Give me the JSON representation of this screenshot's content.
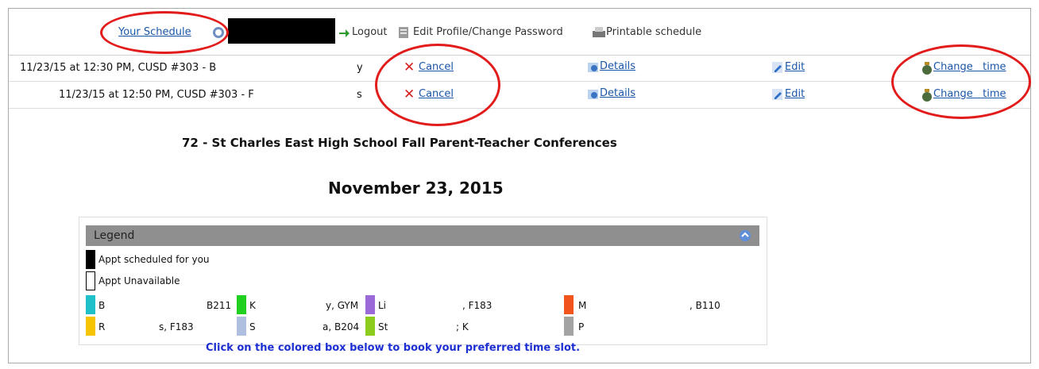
{
  "header": {
    "your_schedule": "Your Schedule",
    "logout": "Logout",
    "edit_profile": "Edit Profile/Change Password",
    "printable": "Printable schedule"
  },
  "appointments": [
    {
      "datetime": "11/23/15 at 12:30 PM, CUSD #303 - B",
      "tail": "y",
      "cancel": "Cancel",
      "details": "Details",
      "edit": "Edit",
      "change_time": "Change   time"
    },
    {
      "datetime": "11/23/15 at 12:50 PM, CUSD #303 - F",
      "tail": "s",
      "cancel": "Cancel",
      "details": "Details",
      "edit": "Edit",
      "change_time": "Change   time"
    }
  ],
  "event": {
    "title": "72 - St Charles East High School Fall Parent-Teacher Conferences",
    "date": "November 23, 2015"
  },
  "legend": {
    "title": "Legend",
    "scheduled": "Appt scheduled for you",
    "unavailable": "Appt Unavailable",
    "rooms": [
      {
        "prefix": "B",
        "suffix": "B211",
        "color": "#1fc0c8"
      },
      {
        "prefix": "K",
        "suffix": "y, GYM",
        "color": "#20d020"
      },
      {
        "prefix": "Li",
        "suffix": ", F183",
        "color": "#9b6ad8"
      },
      {
        "prefix": "M",
        "suffix": ", B110",
        "color": "#f2541e"
      },
      {
        "prefix": "R",
        "suffix": "s, F183",
        "color": "#f6c400"
      },
      {
        "prefix": "S",
        "suffix": "a, B204",
        "color": "#aebfe0"
      },
      {
        "prefix": "St",
        "suffix": "; K",
        "color": "#8ccc1f"
      },
      {
        "prefix": "P",
        "suffix": "",
        "color": "#a3a3a3"
      }
    ]
  },
  "instruction": "Click on the colored box below to book your preferred time slot.",
  "colors": {
    "link": "#1a56a8",
    "annotation_red": "#e21b1b",
    "legend_header": "#8f8f8f",
    "instruction_blue": "#1d2fd2"
  }
}
